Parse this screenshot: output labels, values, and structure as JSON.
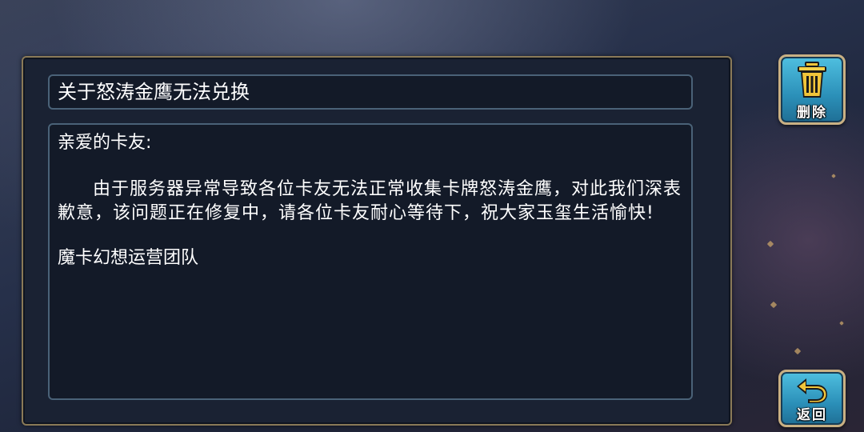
{
  "mail": {
    "subject": "关于怒涛金鹰无法兑换",
    "greeting": "亲爱的卡友:",
    "content": "由于服务器异常导致各位卡友无法正常收集卡牌怒涛金鹰，对此我们深表歉意，该问题正在修复中，请各位卡友耐心等待下，祝大家玉玺生活愉快!",
    "signature": "魔卡幻想运营团队"
  },
  "buttons": {
    "delete_label": "删除",
    "back_label": "返回",
    "delete_icon": "trash-icon",
    "back_icon": "return-arrow-icon"
  },
  "colors": {
    "button_fill": "#2b8fb8",
    "button_border": "#c9b083",
    "panel_border": "#8a7a58",
    "field_border": "#4a6278",
    "text": "#ffffff"
  }
}
